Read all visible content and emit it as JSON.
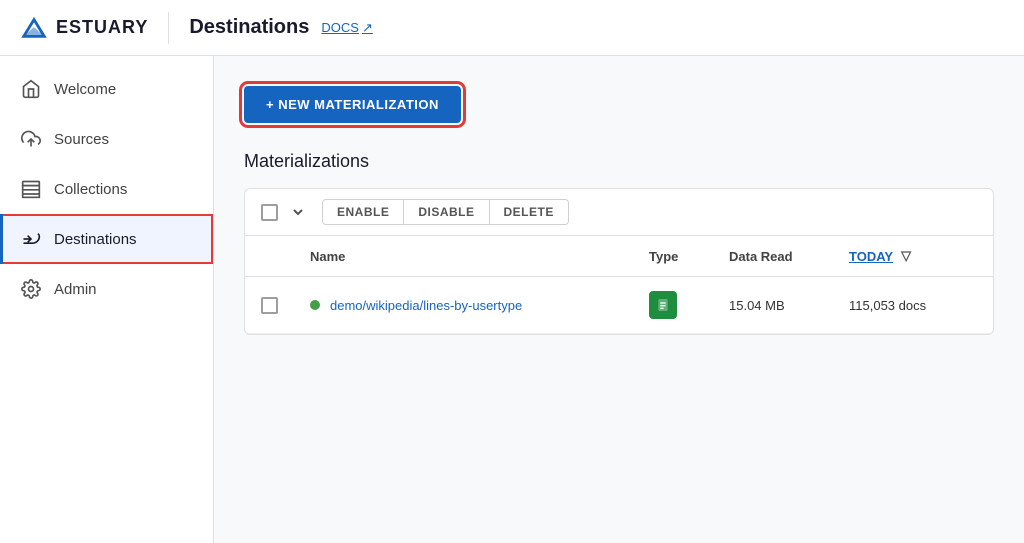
{
  "header": {
    "logo_text": "ESTUARY",
    "page_title": "Destinations",
    "docs_label": "DOCS",
    "external_icon": "⬡"
  },
  "sidebar": {
    "items": [
      {
        "id": "welcome",
        "label": "Welcome",
        "icon": "home"
      },
      {
        "id": "sources",
        "label": "Sources",
        "icon": "upload"
      },
      {
        "id": "collections",
        "label": "Collections",
        "icon": "database"
      },
      {
        "id": "destinations",
        "label": "Destinations",
        "icon": "download",
        "active": true
      },
      {
        "id": "admin",
        "label": "Admin",
        "icon": "settings"
      }
    ]
  },
  "content": {
    "new_btn_label": "+ NEW MATERIALIZATION",
    "section_title": "Materializations",
    "toolbar": {
      "enable_label": "ENABLE",
      "disable_label": "DISABLE",
      "delete_label": "DELETE"
    },
    "table": {
      "columns": [
        {
          "id": "checkbox",
          "label": ""
        },
        {
          "id": "name",
          "label": "Name"
        },
        {
          "id": "type",
          "label": "Type"
        },
        {
          "id": "data_read",
          "label": "Data Read"
        },
        {
          "id": "today",
          "label": "TODAY"
        }
      ],
      "rows": [
        {
          "name": "demo/wikipedia/lines-by-usertype",
          "type_icon": "sheets",
          "data_read": "15.04 MB",
          "today": "115,053 docs",
          "status": "active"
        }
      ]
    }
  }
}
